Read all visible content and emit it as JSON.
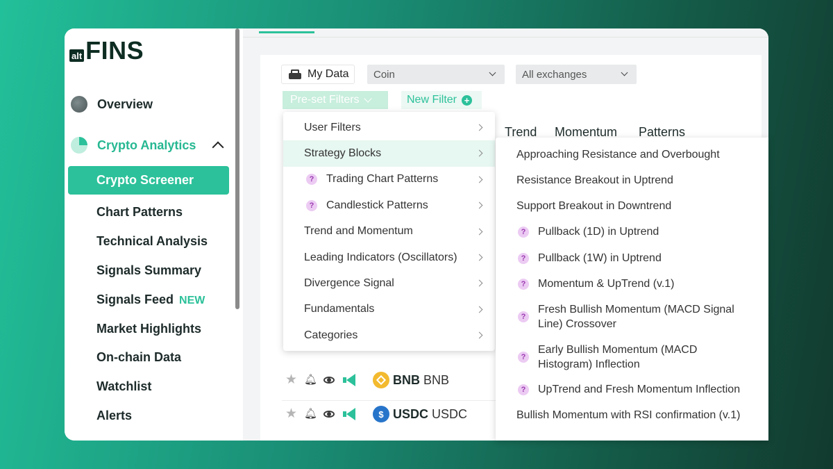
{
  "logo": {
    "alt": "alt",
    "fins": "FINS"
  },
  "sidebar": {
    "overview": "Overview",
    "crypto_analytics": "Crypto Analytics",
    "active": "Crypto Screener",
    "items": [
      {
        "label": "Chart Patterns"
      },
      {
        "label": "Technical Analysis"
      },
      {
        "label": "Signals Summary"
      },
      {
        "label": "Signals Feed",
        "badge": "NEW"
      },
      {
        "label": "Market Highlights"
      },
      {
        "label": "On-chain Data"
      },
      {
        "label": "Watchlist"
      },
      {
        "label": "Alerts"
      }
    ]
  },
  "toolbar": {
    "my_data": "My Data",
    "coin_select": "Coin",
    "exchange_select": "All exchanges",
    "preset_filters": "Pre-set Filters",
    "new_filter": "New Filter"
  },
  "columns": [
    "Trend",
    "Momentum",
    "Patterns"
  ],
  "rows": [
    {
      "symbol": "BNB",
      "name": "BNB"
    },
    {
      "symbol": "USDC",
      "name": "USDC"
    }
  ],
  "dropdown": {
    "items": [
      {
        "label": "User Filters",
        "help": false
      },
      {
        "label": "Strategy Blocks",
        "help": false
      },
      {
        "label": "Trading Chart Patterns",
        "help": true
      },
      {
        "label": "Candlestick Patterns",
        "help": true
      },
      {
        "label": "Trend and Momentum",
        "help": false
      },
      {
        "label": "Leading Indicators (Oscillators)",
        "help": false
      },
      {
        "label": "Divergence Signal",
        "help": false
      },
      {
        "label": "Fundamentals",
        "help": false
      },
      {
        "label": "Categories",
        "help": false
      }
    ]
  },
  "submenu": {
    "items": [
      {
        "label": "Approaching Resistance and Overbought",
        "help": false
      },
      {
        "label": "Resistance Breakout in Uptrend",
        "help": false
      },
      {
        "label": "Support Breakout in Downtrend",
        "help": false
      },
      {
        "label": "Pullback (1D) in Uptrend",
        "help": true
      },
      {
        "label": "Pullback (1W) in Uptrend",
        "help": true
      },
      {
        "label": "Momentum & UpTrend (v.1)",
        "help": true
      },
      {
        "label": "Fresh Bullish Momentum (MACD Signal Line) Crossover",
        "help": true
      },
      {
        "label": "Early Bullish Momentum (MACD Histogram) Inflection",
        "help": true
      },
      {
        "label": "UpTrend and Fresh Momentum Inflection",
        "help": true
      },
      {
        "label": "Bullish Momentum with RSI confirmation (v.1)",
        "help": false
      }
    ]
  },
  "colors": {
    "accent": "#2cc19a",
    "dark": "#0e2d22",
    "help_bg": "#eccbf3",
    "help_fg": "#9b3ab0"
  }
}
